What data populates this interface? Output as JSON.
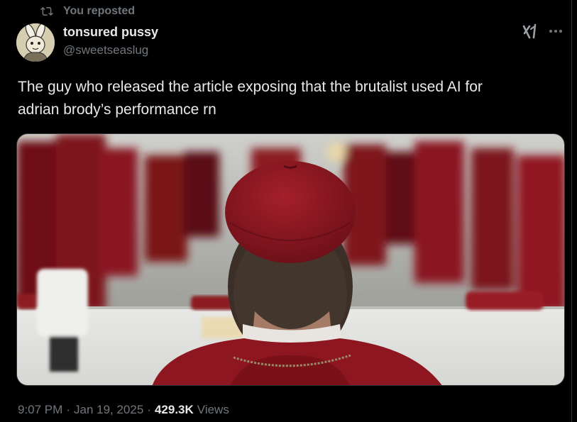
{
  "repost": {
    "label": "You reposted",
    "icon": "repost-icon"
  },
  "author": {
    "display_name": "tonsured pussy",
    "handle": "@sweetseaslug",
    "avatar_icon": "avatar-cartoon-rabbit-monk"
  },
  "header_actions": {
    "grok_icon": "grok-icon",
    "more_icon": "more-icon"
  },
  "tweet": {
    "text": "The guy who released the article exposing that the brutalist used AI for\nadrian brody’s performance rn"
  },
  "media": {
    "description_icon": "photo-cardinal-back-of-head"
  },
  "meta": {
    "time": "9:07 PM",
    "date": "Jan 19, 2025",
    "views_count": "429.3K",
    "views_label": "Views"
  },
  "colors": {
    "background": "#000000",
    "text_primary": "#e7e9ea",
    "text_secondary": "#71767b",
    "border": "#2f3336",
    "cardinal_red": "#8e1620"
  }
}
